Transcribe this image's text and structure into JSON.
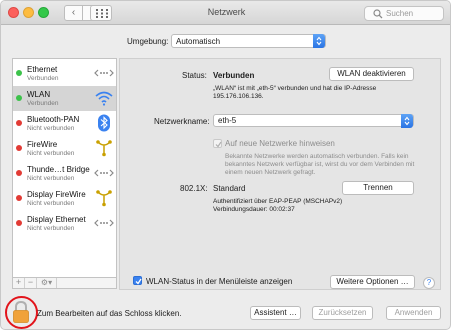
{
  "window": {
    "title": "Netzwerk"
  },
  "toolbar": {
    "back": "‹",
    "forward": "›",
    "search_placeholder": "Suchen"
  },
  "location": {
    "label": "Umgebung:",
    "value": "Automatisch"
  },
  "sidebar": {
    "items": [
      {
        "name": "Ethernet",
        "status": "Verbunden",
        "dot": "green",
        "icon": "ethernet-icon"
      },
      {
        "name": "WLAN",
        "status": "Verbunden",
        "dot": "green",
        "icon": "wifi-icon"
      },
      {
        "name": "Bluetooth-PAN",
        "status": "Nicht verbunden",
        "dot": "red",
        "icon": "bluetooth-icon"
      },
      {
        "name": "FireWire",
        "status": "Nicht verbunden",
        "dot": "red",
        "icon": "firewire-icon"
      },
      {
        "name": "Thunde…t Bridge",
        "status": "Nicht verbunden",
        "dot": "red",
        "icon": "ethernet-icon"
      },
      {
        "name": "Display FireWire",
        "status": "Nicht verbunden",
        "dot": "red",
        "icon": "firewire-icon"
      },
      {
        "name": "Display Ethernet",
        "status": "Nicht verbunden",
        "dot": "red",
        "icon": "ethernet-icon"
      }
    ],
    "add_label": "+",
    "remove_label": "−",
    "gear_label": "⚙︎▾"
  },
  "detail": {
    "status_label": "Status:",
    "status_value": "Verbunden",
    "wlan_toggle_label": "WLAN deaktivieren",
    "status_desc_line1": "„WLAN“ ist mit „eth-5“ verbunden und hat die IP-Adresse",
    "status_desc_line2": "195.176.106.136.",
    "network_name_label": "Netzwerkname:",
    "network_name_value": "eth-5",
    "ask_new_networks_label": "Auf neue Netzwerke hinweisen",
    "ask_desc_line1": "Bekannte Netzwerke werden automatisch verbunden. Falls kein",
    "ask_desc_line2": "bekanntes Netzwerk verfügbar ist, wirst du vor dem Verbinden mit",
    "ask_desc_line3": "einem neuen Netzwerk gefragt.",
    "auth_label": "802.1X:",
    "auth_value": "Standard",
    "disconnect_label": "Trennen",
    "auth_detail_line1": "Authentifiziert über EAP-PEAP (MSCHAPv2)",
    "auth_detail_line2": "Verbindungsdauer: 00:02:37",
    "menubar_status_label": "WLAN-Status in der Menüleiste anzeigen",
    "advanced_label": "Weitere Optionen …",
    "help_label": "?"
  },
  "footer": {
    "lock_text": "Zum Bearbeiten auf das Schloss klicken.",
    "assistant_label": "Assistent …",
    "revert_label": "Zurücksetzen",
    "apply_label": "Anwenden"
  },
  "colors": {
    "accent": "#3a82f0",
    "connected": "#3cc24a",
    "disconnected": "#e23b35",
    "highlight_ring": "#e2141b",
    "lock": "#f0a23a"
  }
}
